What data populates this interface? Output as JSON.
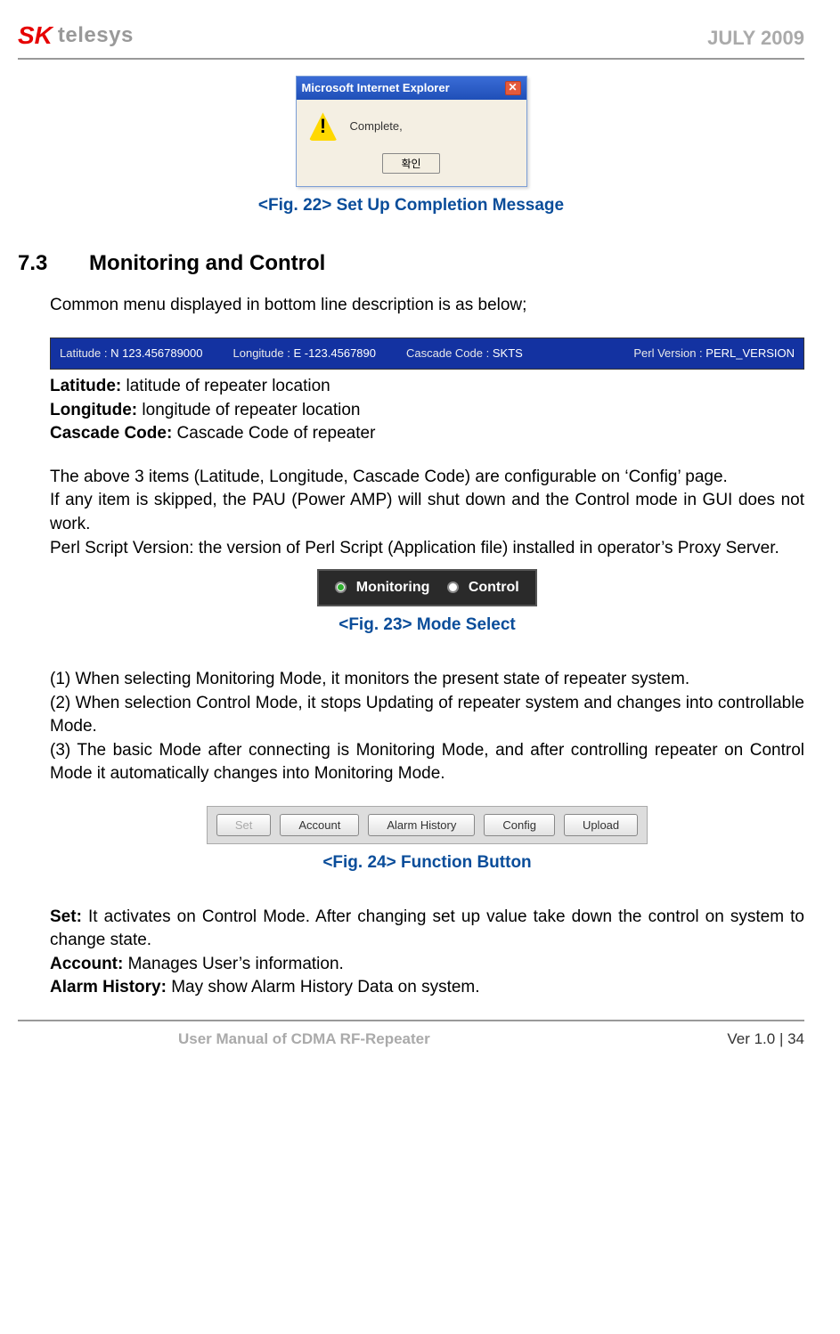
{
  "header": {
    "logo_prefix": "SK",
    "logo_suffix": "telesys",
    "date": "JULY 2009"
  },
  "fig22": {
    "dialog_title": "Microsoft Internet Explorer",
    "message": "Complete,",
    "ok_label": "확인",
    "caption": "<Fig. 22> Set Up Completion Message"
  },
  "section": {
    "num": "7.3",
    "title": "Monitoring and Control"
  },
  "intro": "Common menu displayed in bottom line description is as below;",
  "statusbar": {
    "lat_label": "Latitude :",
    "lat_val": "N 123.456789000",
    "lon_label": "Longitude :",
    "lon_val": "E -123.4567890",
    "casc_label": "Cascade Code :",
    "casc_val": "SKTS",
    "perl_label": "Perl Version :",
    "perl_val": "PERL_VERSION"
  },
  "defs": {
    "lat_term": "Latitude:",
    "lat_desc": " latitude of repeater location",
    "lon_term": "Longitude:",
    "lon_desc": " longitude of repeater location",
    "casc_term": "Cascade Code:",
    "casc_desc": " Cascade Code of repeater"
  },
  "note1": "The above 3 items (Latitude, Longitude, Cascade Code) are configurable on ‘Config’ page.",
  "note2": "If any item is skipped, the PAU (Power AMP) will shut down and the Control mode in GUI does not work.",
  "note3": "Perl Script Version: the version of Perl Script (Application file) installed in operator’s Proxy Server.",
  "fig23": {
    "opt1": "Monitoring",
    "opt2": "Control",
    "caption": "<Fig. 23> Mode Select"
  },
  "modes": {
    "m1": "(1) When selecting Monitoring Mode, it monitors the present state of repeater system.",
    "m2": "(2) When selection Control Mode, it stops Updating of repeater system and changes into controllable Mode.",
    "m3": "(3) The basic Mode after connecting is Monitoring Mode, and after controlling repeater on Control Mode it automatically changes into Monitoring Mode."
  },
  "fig24": {
    "buttons": [
      "Set",
      "Account",
      "Alarm History",
      "Config",
      "Upload"
    ],
    "caption": "<Fig. 24> Function Button"
  },
  "funcdesc": {
    "set_term": "Set:",
    "set_desc": " It activates on Control Mode. After changing set up value take down the control on system to change state.",
    "acc_term": "Account:",
    "acc_desc": "   Manages User’s information.",
    "alarm_term": "Alarm History:",
    "alarm_desc": " May show Alarm History Data on system."
  },
  "footer": {
    "title": "User Manual of CDMA RF-Repeater",
    "ver": "Ver 1.0 |   34"
  }
}
